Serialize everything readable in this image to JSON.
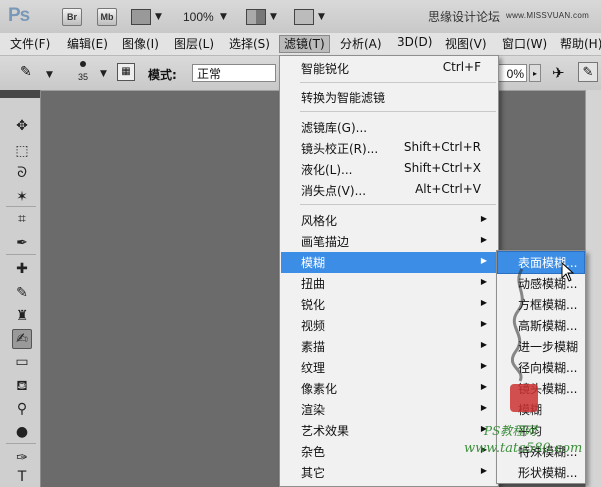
{
  "appbar": {
    "logo": "Ps",
    "buttons": [
      "Br",
      "Mb"
    ],
    "zoom": "100%",
    "site_text": "思缘设计论坛",
    "site_url": "www.MISSVUAN.com"
  },
  "menubar": {
    "items": [
      {
        "label": "文件(F)"
      },
      {
        "label": "编辑(E)"
      },
      {
        "label": "图像(I)"
      },
      {
        "label": "图层(L)"
      },
      {
        "label": "选择(S)"
      },
      {
        "label": "滤镜(T)"
      },
      {
        "label": "分析(A)"
      },
      {
        "label": "3D(D)"
      },
      {
        "label": "视图(V)"
      },
      {
        "label": "窗口(W)"
      },
      {
        "label": "帮助(H)"
      }
    ],
    "active_index": 5
  },
  "options": {
    "brush_size": "35",
    "mode_label": "模式:",
    "mode_value": "正常",
    "opacity_value": "0%"
  },
  "filter_menu": {
    "items": [
      {
        "label": "智能锐化",
        "shortcut": "Ctrl+F",
        "submenu": false
      },
      {
        "sep": true
      },
      {
        "label": "转换为智能滤镜",
        "shortcut": "",
        "submenu": false
      },
      {
        "sep": true
      },
      {
        "label": "滤镜库(G)...",
        "shortcut": "",
        "submenu": false
      },
      {
        "label": "镜头校正(R)...",
        "shortcut": "Shift+Ctrl+R",
        "submenu": false
      },
      {
        "label": "液化(L)...",
        "shortcut": "Shift+Ctrl+X",
        "submenu": false
      },
      {
        "label": "消失点(V)...",
        "shortcut": "Alt+Ctrl+V",
        "submenu": false
      },
      {
        "sep": true
      },
      {
        "label": "风格化",
        "shortcut": "",
        "submenu": true
      },
      {
        "label": "画笔描边",
        "shortcut": "",
        "submenu": true
      },
      {
        "label": "模糊",
        "shortcut": "",
        "submenu": true,
        "highlighted": true
      },
      {
        "label": "扭曲",
        "shortcut": "",
        "submenu": true
      },
      {
        "label": "锐化",
        "shortcut": "",
        "submenu": true
      },
      {
        "label": "视频",
        "shortcut": "",
        "submenu": true
      },
      {
        "label": "素描",
        "shortcut": "",
        "submenu": true
      },
      {
        "label": "纹理",
        "shortcut": "",
        "submenu": true
      },
      {
        "label": "像素化",
        "shortcut": "",
        "submenu": true
      },
      {
        "label": "渲染",
        "shortcut": "",
        "submenu": true
      },
      {
        "label": "艺术效果",
        "shortcut": "",
        "submenu": true
      },
      {
        "label": "杂色",
        "shortcut": "",
        "submenu": true
      },
      {
        "label": "其它",
        "shortcut": "",
        "submenu": true
      }
    ]
  },
  "blur_menu": {
    "items": [
      {
        "label": "表面模糊...",
        "highlighted": true
      },
      {
        "label": "动感模糊..."
      },
      {
        "label": "方框模糊..."
      },
      {
        "label": "高斯模糊..."
      },
      {
        "label": "进一步模糊"
      },
      {
        "label": "径向模糊..."
      },
      {
        "label": "镜头模糊..."
      },
      {
        "label": "模糊"
      },
      {
        "label": "平均"
      },
      {
        "label": "特殊模糊..."
      },
      {
        "label": "形状模糊..."
      }
    ]
  },
  "watermark": {
    "brand": "PS教程网",
    "url": "www.tata580.com"
  },
  "colors": {
    "highlight": "#3b8de6",
    "menu_bg": "#f1f1f1",
    "canvas_bg": "#6b6b6b"
  }
}
